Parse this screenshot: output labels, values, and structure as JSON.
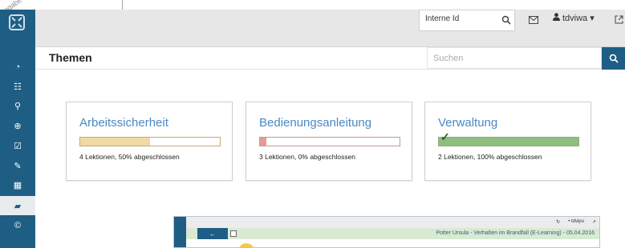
{
  "corner_watermark": "Eingabe (S",
  "sidebar": {
    "logo": "app-logo-icon",
    "items": [
      {
        "icon": "dashboard-icon",
        "glyph": "◔"
      },
      {
        "icon": "sitemap-icon",
        "glyph": "☷"
      },
      {
        "icon": "search-icon",
        "glyph": "⚲"
      },
      {
        "icon": "zoom-search-icon",
        "glyph": "⊕"
      },
      {
        "icon": "checklist-icon",
        "glyph": "☑"
      },
      {
        "icon": "pencil-icon",
        "glyph": "✎"
      },
      {
        "icon": "grid-icon",
        "glyph": "▦"
      },
      {
        "icon": "graduation-cap-icon",
        "glyph": "▰"
      },
      {
        "icon": "copyright-icon",
        "glyph": "©"
      }
    ]
  },
  "header": {
    "id_search_value": "Interne Id",
    "username": "tdviwa",
    "caret": "▾"
  },
  "page": {
    "title": "Themen",
    "search_placeholder": "Suchen"
  },
  "cards": [
    {
      "title": "Arbeitssicherheit",
      "progress": 0.5,
      "fill_color": "#f1d9a3",
      "border_color": "#c8a878",
      "desc": "4 Lektionen, 50% abgeschlossen",
      "completed": false
    },
    {
      "title": "Bedienungsanleitung",
      "progress": 0.0,
      "fill_color": "#e79a98",
      "border_color": "#c99998",
      "desc": "3 Lektionen, 0% abgeschlossen",
      "completed": false
    },
    {
      "title": "Verwaltung",
      "progress": 1.0,
      "fill_color": "#8fbe80",
      "border_color": "#8db07f",
      "desc": "2 Lektionen, 100% abgeschlossen",
      "completed": true
    }
  ],
  "check_mark": "✓",
  "mini_screenshot": {
    "back_arrow": "←",
    "title": "Potter Ursula - Verhalten im Brandfall (E-Learning) - 05.04.2016",
    "top_right": [
      "↻",
      "• tdvipu",
      "↗"
    ]
  }
}
